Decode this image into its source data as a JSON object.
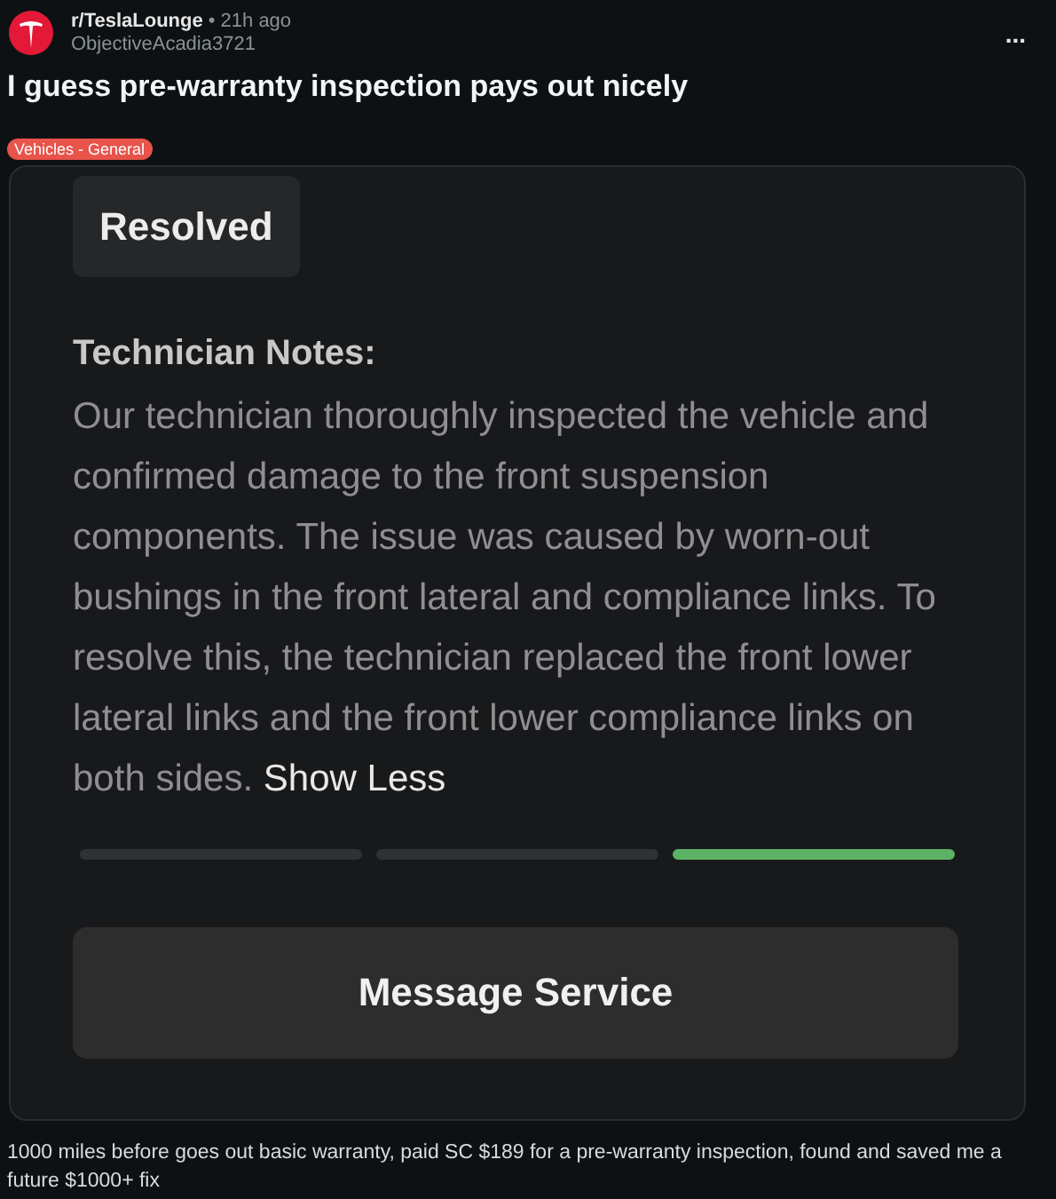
{
  "post": {
    "subreddit": "r/TeslaLounge",
    "time": "• 21h ago",
    "author": "ObjectiveAcadia3721",
    "menu": "...",
    "title": "I guess pre-warranty inspection pays out nicely",
    "flair": "Vehicles - General",
    "body": "1000 miles before goes out basic warranty, paid SC $189 for a pre-warranty inspection, found and saved me a future $1000+ fix"
  },
  "screenshot": {
    "status": "Resolved",
    "notes_heading": "Technician Notes:",
    "notes": "Our technician thoroughly inspected the vehicle and confirmed damage to the front suspension components. The issue was caused by worn-out bushings in the front lateral and compliance links. To resolve this, the technician replaced the front lower lateral links and the front lower compliance links on both sides.",
    "toggle": "Show Less",
    "steps": [
      {
        "selected": false
      },
      {
        "selected": false
      },
      {
        "selected": true
      }
    ],
    "button": "Message Service"
  }
}
